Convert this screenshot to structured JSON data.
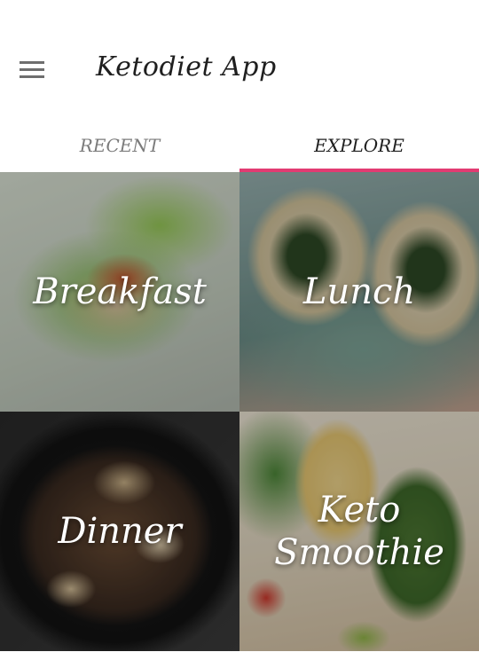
{
  "app_bar": {
    "title": "Ketodiet App",
    "menu_icon": "hamburger-menu-icon"
  },
  "tabs": [
    {
      "label": "RECENT",
      "selected": false
    },
    {
      "label": "EXPLORE",
      "selected": true
    }
  ],
  "accent_color": "#e23b72",
  "categories": [
    {
      "label": "Breakfast"
    },
    {
      "label": "Lunch"
    },
    {
      "label": "Dinner"
    },
    {
      "label": "Keto\nSmoothie"
    }
  ]
}
